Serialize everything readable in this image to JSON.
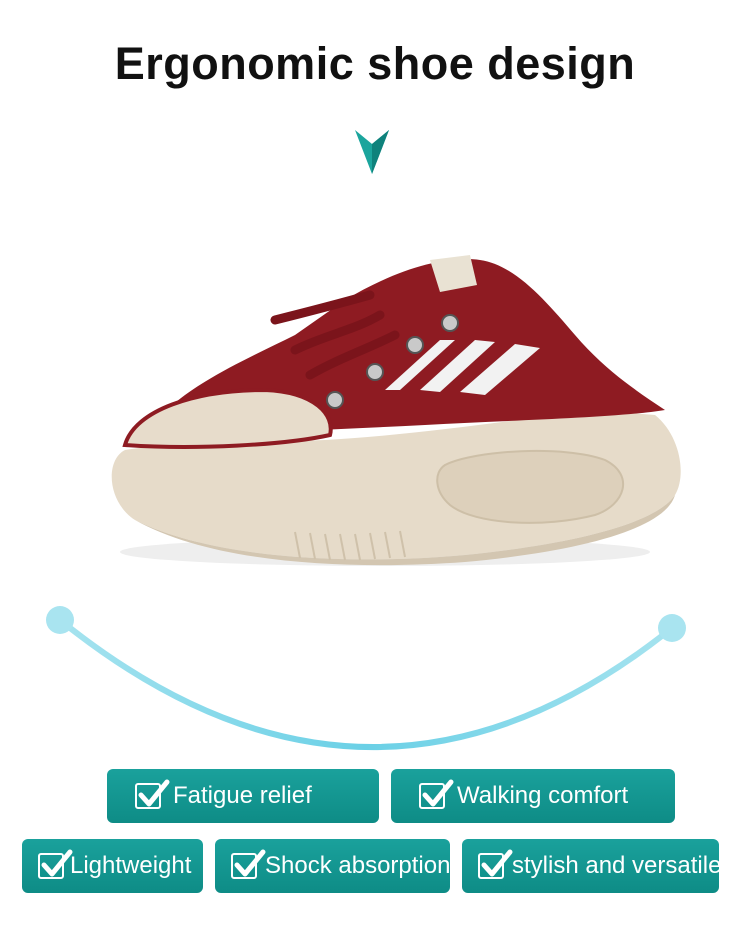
{
  "heading": "Ergonomic shoe design",
  "colors": {
    "accent": "#14978f",
    "shoe_red": "#8e1b22",
    "sole_beige": "#e7dccb",
    "arc": "#7fd5ea"
  },
  "icons": [
    "chevron-down-icon",
    "checkbox-check-icon"
  ],
  "features": [
    {
      "label": "Fatigue relief"
    },
    {
      "label": "Walking comfort"
    },
    {
      "label": "Lightweight"
    },
    {
      "label": "Shock absorption"
    },
    {
      "label": "stylish and versatile"
    }
  ]
}
